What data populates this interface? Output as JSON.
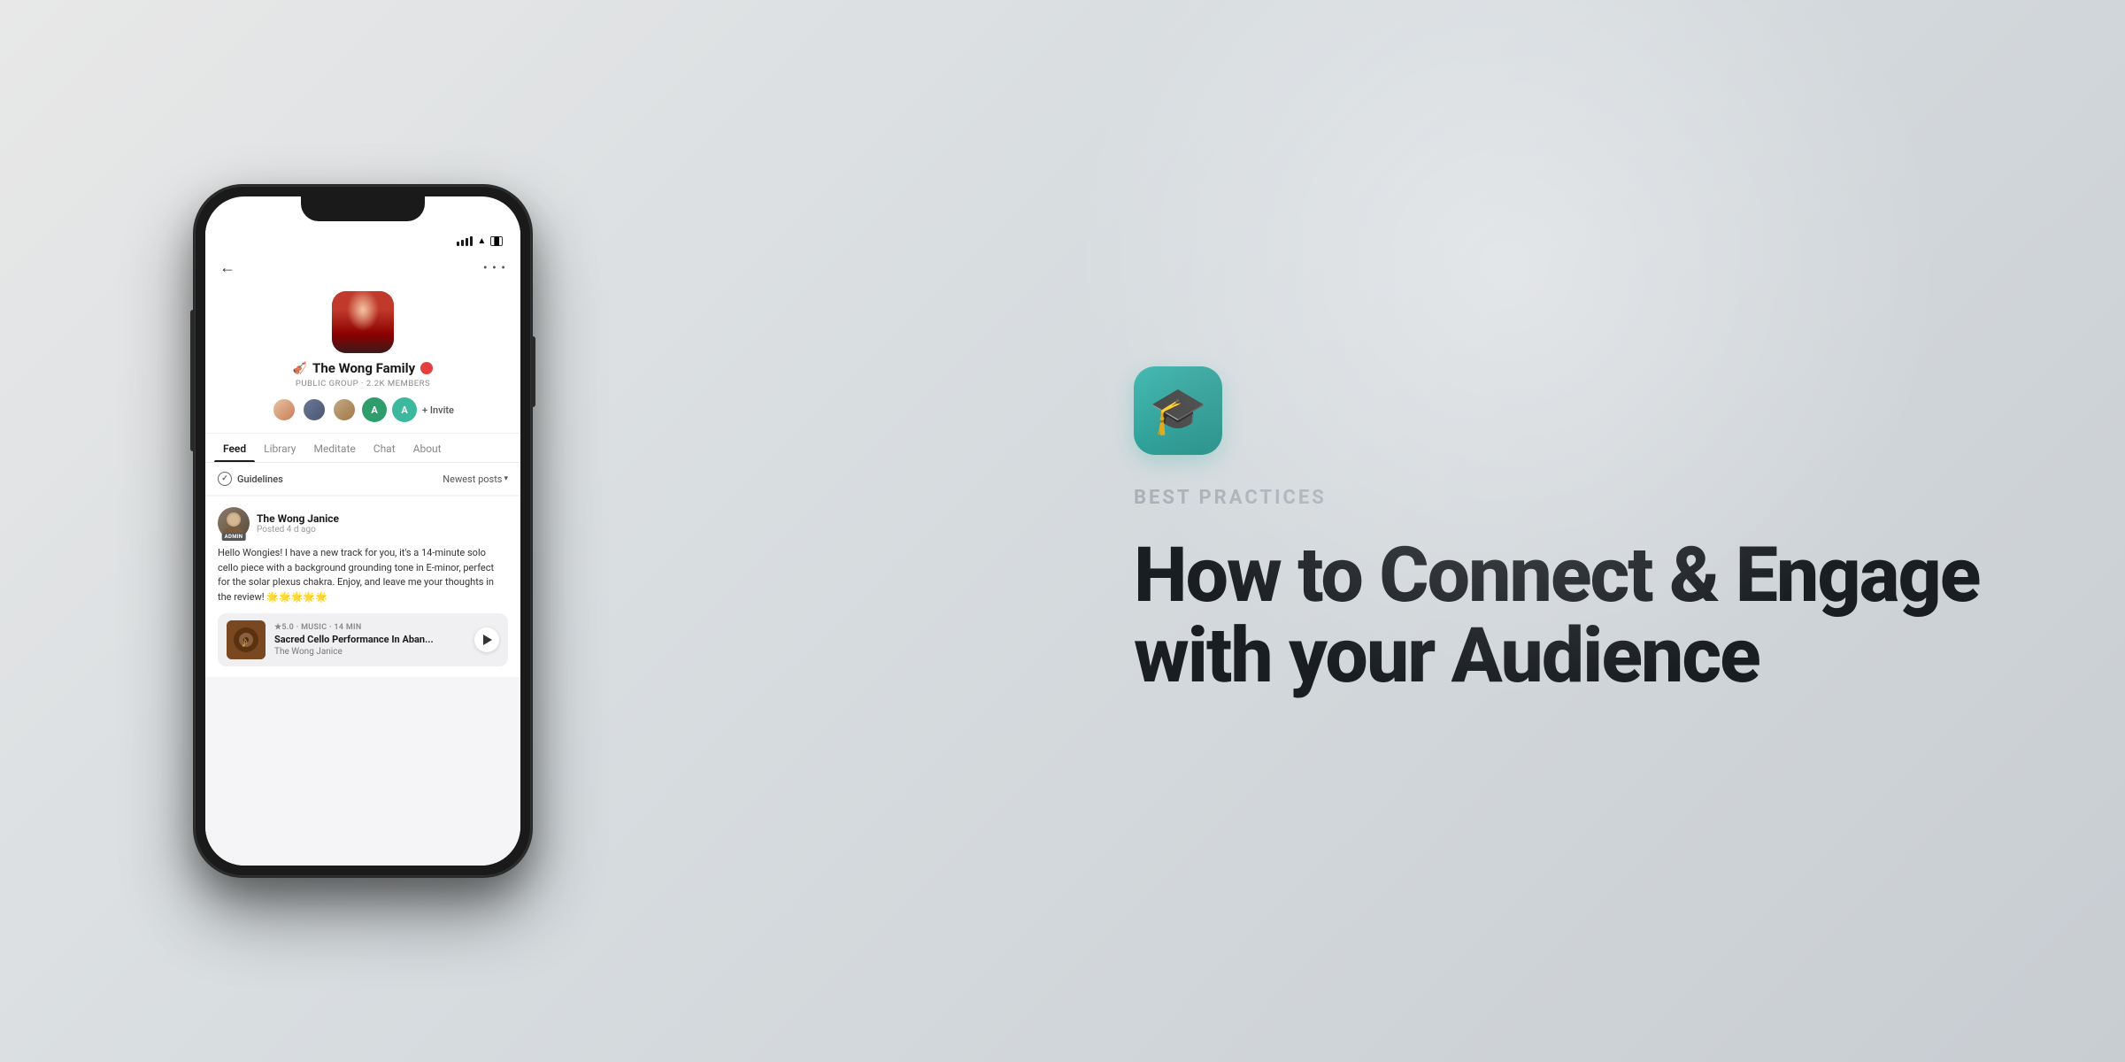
{
  "page": {
    "background": "#d8dde0"
  },
  "phone": {
    "group": {
      "name_emoji": "🎻",
      "name": "The Wong Family",
      "badge_color": "#e53e3e",
      "meta": "PUBLIC GROUP · 2.2K MEMBERS",
      "invite_label": "+ Invite"
    },
    "tabs": [
      {
        "label": "Feed",
        "active": true
      },
      {
        "label": "Library",
        "active": false
      },
      {
        "label": "Meditate",
        "active": false
      },
      {
        "label": "Chat",
        "active": false
      },
      {
        "label": "About",
        "active": false
      }
    ],
    "guidelines": {
      "label": "Guidelines",
      "sort_label": "Newest posts"
    },
    "post": {
      "author": "The Wong Janice",
      "time": "Posted 4 d ago",
      "admin_label": "ADMIN",
      "text": "Hello Wongies! I have a new track for you, it's a 14-minute solo cello piece with a background grounding tone in E-minor, perfect for the solar plexus chakra. Enjoy, and leave me your thoughts in the review! 🌟🌟🌟🌟🌟",
      "music": {
        "rating": "★5.0",
        "category": "MUSIC",
        "duration": "14 MIN",
        "title": "Sacred Cello Performance In Aban...",
        "artist": "The Wong Janice"
      }
    }
  },
  "right": {
    "badge_label": "BEST PRACTICES",
    "headline_line1": "How to Connect & Engage",
    "headline_line2": "with your Audience"
  }
}
